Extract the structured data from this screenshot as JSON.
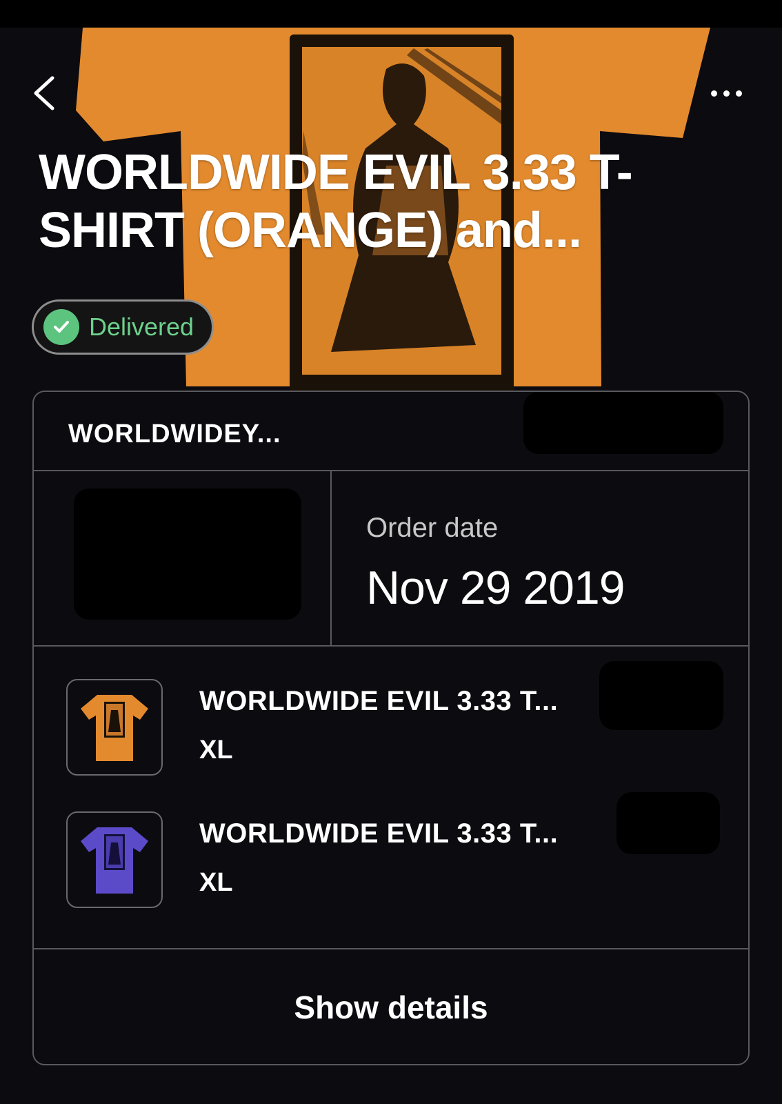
{
  "header": {
    "title": "WORLDWIDE EVIL 3.33 T-SHIRT (ORANGE) and...",
    "status": "Delivered",
    "back_icon": "chevron-left-icon",
    "more_icon": "more-horizontal-icon"
  },
  "order": {
    "store_name": "WORLDWIDEY...",
    "order_date_label": "Order date",
    "order_date": "Nov 29 2019"
  },
  "items": [
    {
      "name": "WORLDWIDE EVIL 3.33 T...",
      "size": "XL",
      "color": "#e38a2e"
    },
    {
      "name": "WORLDWIDE EVIL 3.33 T...",
      "size": "XL",
      "color": "#5b4bc9"
    }
  ],
  "actions": {
    "show_details": "Show details"
  },
  "colors": {
    "background": "#0c0b10",
    "status_green": "#5cc47f",
    "shirt_orange": "#e38a2e",
    "shirt_purple": "#5b4bc9"
  }
}
